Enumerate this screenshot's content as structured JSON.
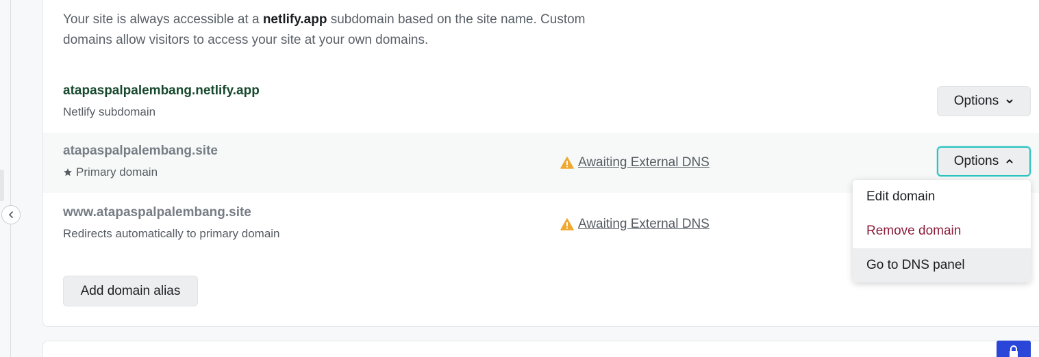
{
  "intro": {
    "part1": "Your site is always accessible at a ",
    "bold": "netlify.app",
    "part2": " subdomain based on the site name. Custom domains allow visitors to access your site at your own domains."
  },
  "domains": [
    {
      "name": "atapaspalpalembang.netlify.app",
      "subtitle": "Netlify subdomain",
      "options_label": "Options"
    },
    {
      "name": "atapaspalpalembang.site",
      "subtitle": "Primary domain",
      "status": "Awaiting External DNS",
      "options_label": "Options"
    },
    {
      "name": "www.atapaspalpalembang.site",
      "subtitle": "Redirects automatically to primary domain",
      "status": "Awaiting External DNS"
    }
  ],
  "add_alias_label": "Add domain alias",
  "menu": {
    "items": [
      {
        "label": "Edit domain"
      },
      {
        "label": "Remove domain"
      },
      {
        "label": "Go to DNS panel"
      }
    ]
  },
  "colors": {
    "accent_focus": "#2bc3c0",
    "danger": "#8b1d3a",
    "warning": "#f0a830",
    "primary": "#2a46d8"
  }
}
